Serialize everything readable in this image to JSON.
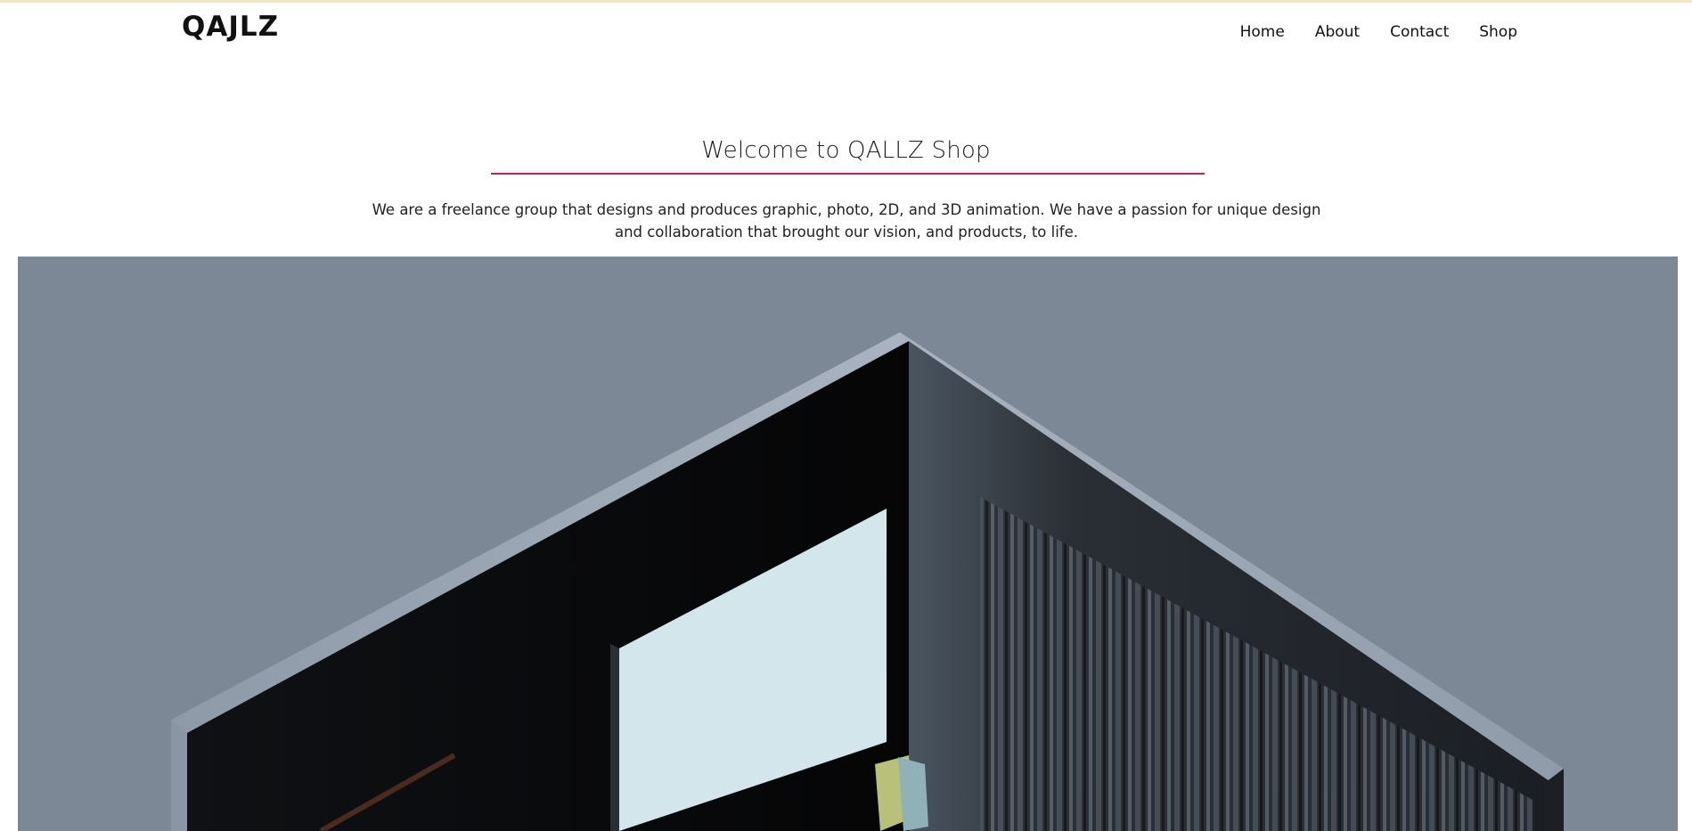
{
  "site": {
    "logo_text": "QAJLZ"
  },
  "nav": {
    "items": [
      {
        "label": "Home"
      },
      {
        "label": "About"
      },
      {
        "label": "Contact"
      },
      {
        "label": "Shop"
      }
    ]
  },
  "hero": {
    "title": "Welcome to QALLZ Shop",
    "description": "We are a freelance group that designs and produces graphic, photo, 2D, and 3D animation. We have a passion for unique design and collaboration that brought our vision, and products, to life."
  },
  "colors": {
    "accent_rule": "#d6175c",
    "image_background": "#7d8896",
    "top_accent": "#f1e6c8"
  },
  "banner_image": {
    "subject": "isometric-room-render"
  }
}
